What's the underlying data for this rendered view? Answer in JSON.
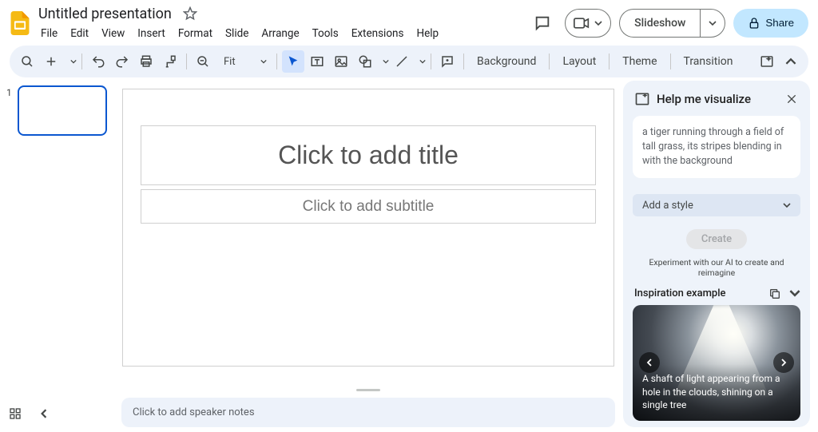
{
  "header": {
    "doc_title": "Untitled presentation",
    "menus": [
      "File",
      "Edit",
      "View",
      "Insert",
      "Format",
      "Slide",
      "Arrange",
      "Tools",
      "Extensions",
      "Help"
    ],
    "slideshow_label": "Slideshow",
    "share_label": "Share"
  },
  "toolbar": {
    "zoom_label": "Fit",
    "background_label": "Background",
    "layout_label": "Layout",
    "theme_label": "Theme",
    "transition_label": "Transition"
  },
  "filmstrip": {
    "slides": [
      {
        "number": "1"
      }
    ]
  },
  "canvas": {
    "title_placeholder": "Click to add title",
    "subtitle_placeholder": "Click to add subtitle",
    "notes_placeholder": "Click to add speaker notes"
  },
  "sidepanel": {
    "title": "Help me visualize",
    "prompt_placeholder": "a tiger running through a field of tall grass, its stripes blending in with the background",
    "style_label": "Add a style",
    "create_label": "Create",
    "hint": "Experiment with our AI to create and reimagine",
    "inspiration_heading": "Inspiration example",
    "card_caption": "A shaft of light appearing from a hole in the clouds, shining on a single tree"
  }
}
